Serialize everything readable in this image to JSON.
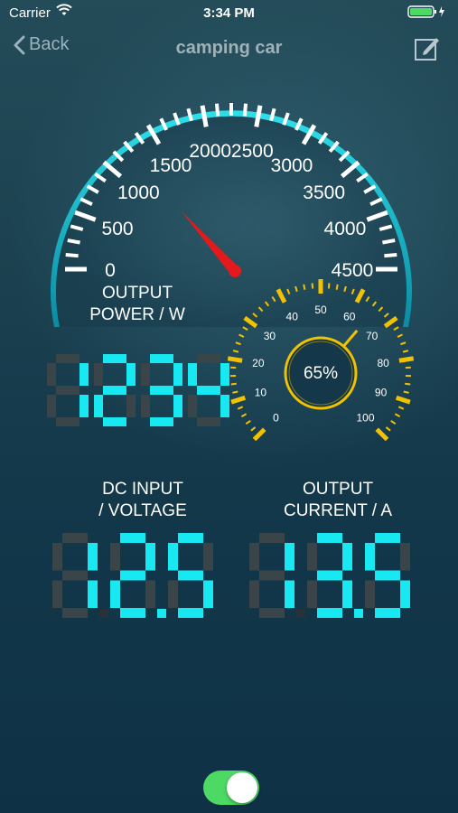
{
  "status_bar": {
    "carrier": "Carrier",
    "time": "3:34 PM"
  },
  "nav": {
    "back_label": "Back",
    "title": "camping car"
  },
  "power_gauge": {
    "ticks": [
      "0",
      "500",
      "1000",
      "1500",
      "2000",
      "2500",
      "3000",
      "3500",
      "4000",
      "4500"
    ],
    "needle_value": 1234,
    "max": 4500,
    "label_line1": "OUTPUT",
    "label_line2": "POWER / W",
    "digital_value": "1234"
  },
  "percent_gauge": {
    "ticks": [
      "0",
      "10",
      "20",
      "30",
      "40",
      "50",
      "60",
      "70",
      "80",
      "90",
      "100"
    ],
    "value_text": "65%",
    "needle_value": 65
  },
  "dc_input": {
    "label_line1": "DC INPUT",
    "label_line2": "/ VOLTAGE",
    "value": "12.5"
  },
  "output_current": {
    "label_line1": "OUTPUT",
    "label_line2": "CURRENT / A",
    "value": "13.5"
  },
  "power_toggle": {
    "on": true
  },
  "colors": {
    "accent_cyan": "#17e8f2",
    "gauge_yellow": "#f2c200",
    "toggle_green": "#4cd964"
  }
}
